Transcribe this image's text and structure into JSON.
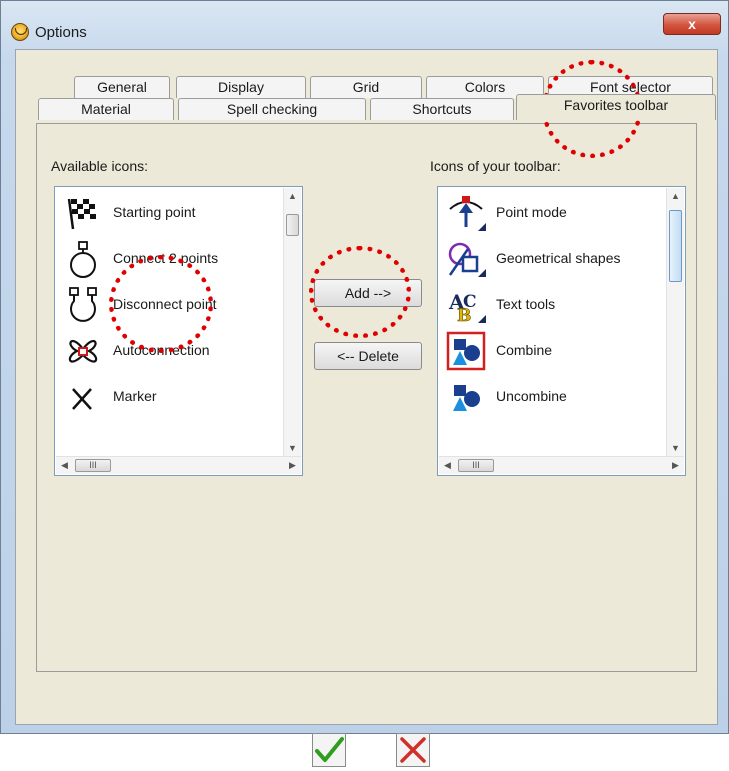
{
  "window": {
    "title": "Options",
    "close_label": "x"
  },
  "tabs_back": [
    "General",
    "Display",
    "Grid",
    "Colors",
    "Font selector"
  ],
  "tabs_front": [
    "Material",
    "Spell checking",
    "Shortcuts",
    "Favorites toolbar"
  ],
  "active_tab": "Favorites toolbar",
  "available": {
    "label": "Available icons:",
    "items": [
      {
        "label": "Starting point",
        "icon": "checkered-flag-icon"
      },
      {
        "label": "Connect 2 points",
        "icon": "connect-point-icon"
      },
      {
        "label": "Disconnect point",
        "icon": "disconnect-point-icon"
      },
      {
        "label": "Autoconnection",
        "icon": "autoconnection-icon"
      },
      {
        "label": "Marker",
        "icon": "marker-x-icon"
      }
    ]
  },
  "toolbar": {
    "label": "Icons of your toolbar:",
    "items": [
      {
        "label": "Point mode",
        "icon": "point-mode-icon"
      },
      {
        "label": "Geometrical shapes",
        "icon": "geometrical-shapes-icon"
      },
      {
        "label": "Text tools",
        "icon": "text-tools-icon"
      },
      {
        "label": "Combine",
        "icon": "combine-icon",
        "selected": true
      },
      {
        "label": "Uncombine",
        "icon": "uncombine-icon"
      }
    ]
  },
  "buttons": {
    "add": "Add -->",
    "delete": "<-- Delete"
  },
  "scrollbar_grip": "III",
  "footer": {
    "ok_icon": "green-check-icon",
    "cancel_icon": "red-x-icon"
  },
  "colors": {
    "annotation": "#e00000",
    "ok": "#2f9e1e",
    "cancel": "#d0302a",
    "selection": "#d22020"
  }
}
